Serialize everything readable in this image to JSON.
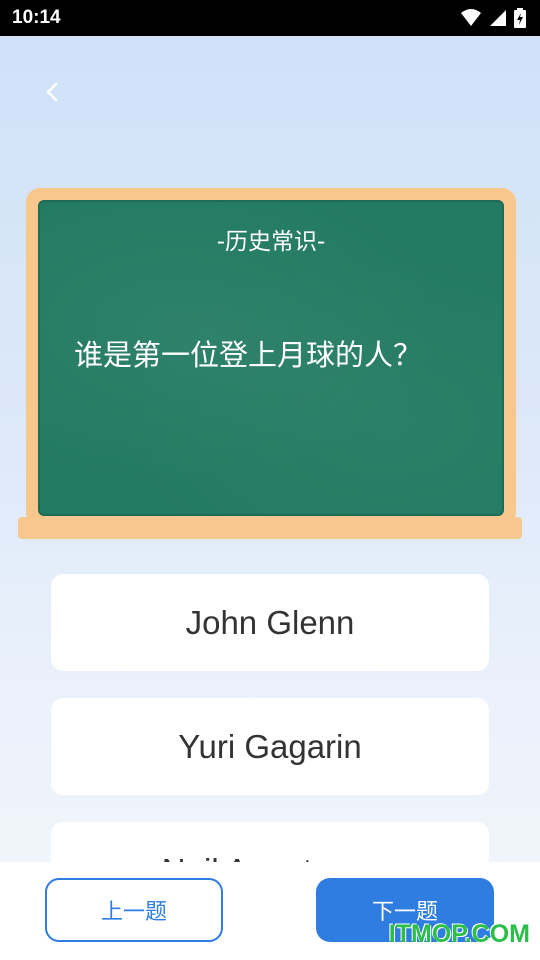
{
  "status_bar": {
    "time": "10:14",
    "icons": [
      "wifi-icon",
      "cell-signal-icon",
      "battery-charging-icon"
    ]
  },
  "nav": {
    "back_icon": "chevron-left-icon"
  },
  "quiz": {
    "category": "-历史常识-",
    "question": "谁是第一位登上月球的人？"
  },
  "answers": [
    {
      "label": "John Glenn"
    },
    {
      "label": "Yuri Gagarin"
    },
    {
      "label": "Neil Armstrong"
    }
  ],
  "footer": {
    "prev_label": "上一题",
    "next_label": "下一题"
  },
  "watermark": "ITMOP.COM",
  "colors": {
    "accent": "#2f7de1",
    "board": "#237a62",
    "board_frame": "#f7c78c",
    "watermark": "#2bbf4a"
  }
}
